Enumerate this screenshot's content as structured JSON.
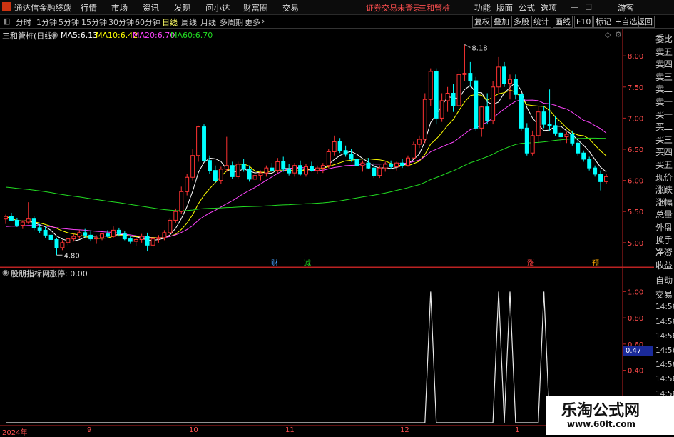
{
  "topbar": {
    "app_title": "通达信金融终端",
    "menus": [
      "行情",
      "市场",
      "资讯",
      "发现",
      "问小达",
      "财富圈",
      "交易"
    ],
    "alert": "证券交易未登录",
    "stock_name": "三和管桩",
    "right": [
      "功能",
      "版面",
      "公式",
      "选项"
    ],
    "user": "游客"
  },
  "periods": {
    "items": [
      "分时",
      "1分钟",
      "5分钟",
      "15分钟",
      "30分钟",
      "60分钟",
      "日线",
      "周线",
      "月线",
      "多周期",
      "更多"
    ],
    "active": "日线"
  },
  "toolbar": {
    "buttons": [
      "复权",
      "叠加",
      "多股",
      "统计",
      "画线",
      "F10",
      "标记",
      "+自选",
      "返回"
    ]
  },
  "side_panel": {
    "items": [
      "委比",
      "卖五",
      "卖四",
      "卖三",
      "卖二",
      "卖一",
      "买一",
      "买二",
      "买三",
      "买四",
      "买五",
      "现价",
      "涨跌",
      "涨幅",
      "总量",
      "外盘",
      "换手",
      "净资",
      "收益"
    ]
  },
  "main_chart": {
    "title": "三和管桩(日线)",
    "ma": [
      {
        "name": "MA5:",
        "value": "6.13",
        "color": "#ffffff"
      },
      {
        "name": "MA10:",
        "value": "6.42",
        "color": "#ffff00"
      },
      {
        "name": "MA20:",
        "value": "6.70",
        "color": "#ff44ff"
      },
      {
        "name": "MA60:",
        "value": "6.70",
        "color": "#22dd22"
      }
    ],
    "high_label": "8.18",
    "low_label": "4.80",
    "event_tags": [
      {
        "text": "财",
        "color": "#4aa3ff"
      },
      {
        "text": "减",
        "color": "#22dd22"
      },
      {
        "text": "涨",
        "color": "#ff4040"
      },
      {
        "text": "预",
        "color": "#ffaa00"
      }
    ],
    "y_ticks": [
      "8.00",
      "7.50",
      "7.00",
      "6.50",
      "6.00",
      "5.50",
      "5.00"
    ]
  },
  "sub_chart": {
    "title": "股朋指标网",
    "indicator": "涨停: 0.00",
    "y_ticks": [
      "1.00",
      "0.80",
      "0.60",
      "0.40"
    ],
    "current_value": "0.47",
    "side_items": [
      "自动",
      "交易",
      "14:56",
      "14:56",
      "14:56",
      "14:56",
      "14:56",
      "14:56",
      "14:56",
      "14:56"
    ]
  },
  "date_axis": [
    "2024年",
    "9",
    "10",
    "11",
    "12",
    "1"
  ],
  "watermark": {
    "title": "乐淘公式网",
    "url": "www.60lt.com"
  },
  "colors": {
    "up": "#ff3232",
    "down": "#00ffff",
    "ma5": "#ffffff",
    "ma10": "#ffff00",
    "ma20": "#ff44ff",
    "ma60": "#22dd22"
  },
  "chart_data": {
    "type": "candlestick",
    "title": "三和管桩(日线)",
    "ylim": [
      4.7,
      8.3
    ],
    "annotations": {
      "high": 8.18,
      "low": 4.8
    },
    "candles": [
      [
        5.38,
        5.45,
        5.3,
        5.42
      ],
      [
        5.42,
        5.48,
        5.35,
        5.36
      ],
      [
        5.36,
        5.4,
        5.25,
        5.28
      ],
      [
        5.28,
        5.36,
        5.22,
        5.33
      ],
      [
        5.33,
        5.65,
        5.3,
        5.38
      ],
      [
        5.38,
        5.42,
        5.2,
        5.24
      ],
      [
        5.24,
        5.3,
        5.15,
        5.2
      ],
      [
        5.2,
        5.26,
        5.08,
        5.12
      ],
      [
        5.12,
        5.18,
        5.0,
        5.05
      ],
      [
        5.05,
        5.08,
        4.8,
        4.92
      ],
      [
        4.92,
        5.04,
        4.88,
        5.0
      ],
      [
        5.0,
        5.08,
        4.96,
        5.06
      ],
      [
        5.06,
        5.14,
        5.02,
        5.1
      ],
      [
        5.1,
        5.2,
        5.06,
        5.16
      ],
      [
        5.16,
        5.22,
        5.08,
        5.12
      ],
      [
        5.12,
        5.18,
        5.02,
        5.06
      ],
      [
        5.06,
        5.12,
        4.98,
        5.08
      ],
      [
        5.08,
        5.16,
        5.04,
        5.14
      ],
      [
        5.14,
        5.2,
        5.08,
        5.1
      ],
      [
        5.1,
        5.26,
        5.08,
        5.2
      ],
      [
        5.2,
        5.24,
        5.1,
        5.14
      ],
      [
        5.14,
        5.18,
        5.04,
        5.06
      ],
      [
        5.06,
        5.1,
        4.98,
        5.02
      ],
      [
        5.02,
        5.08,
        4.95,
        5.05
      ],
      [
        5.05,
        5.14,
        5.0,
        5.1
      ],
      [
        5.1,
        5.16,
        4.86,
        4.96
      ],
      [
        4.96,
        5.1,
        4.9,
        5.06
      ],
      [
        5.06,
        5.12,
        5.0,
        5.08
      ],
      [
        5.08,
        5.2,
        5.04,
        5.16
      ],
      [
        5.16,
        5.4,
        5.12,
        5.36
      ],
      [
        5.36,
        5.55,
        5.32,
        5.5
      ],
      [
        5.5,
        5.9,
        5.46,
        5.82
      ],
      [
        5.82,
        6.1,
        5.76,
        6.05
      ],
      [
        6.05,
        6.5,
        6.0,
        6.4
      ],
      [
        6.4,
        6.88,
        6.3,
        6.86
      ],
      [
        6.86,
        6.9,
        6.3,
        6.32
      ],
      [
        6.32,
        6.4,
        6.1,
        6.16
      ],
      [
        6.16,
        6.24,
        5.96,
        6.0
      ],
      [
        6.0,
        6.22,
        5.94,
        6.18
      ],
      [
        6.18,
        6.7,
        6.14,
        6.24
      ],
      [
        6.24,
        6.3,
        6.02,
        6.06
      ],
      [
        6.06,
        6.3,
        6.02,
        6.26
      ],
      [
        6.26,
        6.34,
        6.14,
        6.18
      ],
      [
        6.18,
        6.24,
        5.98,
        6.02
      ],
      [
        6.02,
        6.1,
        5.94,
        6.08
      ],
      [
        6.08,
        6.16,
        6.0,
        6.12
      ],
      [
        6.12,
        6.24,
        6.06,
        6.2
      ],
      [
        6.2,
        6.28,
        6.12,
        6.16
      ],
      [
        6.16,
        6.36,
        6.12,
        6.3
      ],
      [
        6.3,
        6.38,
        6.14,
        6.18
      ],
      [
        6.18,
        6.26,
        6.08,
        6.12
      ],
      [
        6.12,
        6.28,
        6.06,
        6.24
      ],
      [
        6.24,
        6.32,
        6.08,
        6.1
      ],
      [
        6.1,
        6.26,
        6.06,
        6.22
      ],
      [
        6.22,
        6.3,
        6.14,
        6.16
      ],
      [
        6.16,
        6.24,
        6.1,
        6.2
      ],
      [
        6.2,
        6.28,
        6.12,
        6.24
      ],
      [
        6.24,
        6.5,
        6.2,
        6.46
      ],
      [
        6.46,
        6.72,
        6.4,
        6.62
      ],
      [
        6.62,
        6.68,
        6.44,
        6.48
      ],
      [
        6.48,
        6.56,
        6.38,
        6.42
      ],
      [
        6.42,
        6.5,
        6.3,
        6.34
      ],
      [
        6.34,
        6.4,
        6.2,
        6.24
      ],
      [
        6.24,
        6.32,
        6.14,
        6.28
      ],
      [
        6.28,
        6.36,
        6.18,
        6.2
      ],
      [
        6.2,
        6.28,
        6.04,
        6.08
      ],
      [
        6.08,
        6.24,
        6.04,
        6.2
      ],
      [
        6.2,
        6.3,
        6.14,
        6.26
      ],
      [
        6.26,
        6.32,
        6.18,
        6.22
      ],
      [
        6.22,
        6.3,
        6.16,
        6.28
      ],
      [
        6.28,
        6.34,
        6.2,
        6.24
      ],
      [
        6.24,
        6.4,
        6.22,
        6.36
      ],
      [
        6.36,
        6.62,
        6.34,
        6.58
      ],
      [
        6.58,
        6.72,
        6.52,
        6.66
      ],
      [
        6.66,
        7.4,
        6.6,
        7.3
      ],
      [
        7.3,
        7.8,
        7.2,
        7.75
      ],
      [
        7.75,
        7.8,
        6.9,
        7.0
      ],
      [
        7.0,
        7.4,
        6.94,
        7.28
      ],
      [
        7.28,
        7.5,
        7.1,
        7.4
      ],
      [
        7.4,
        7.55,
        7.1,
        7.2
      ],
      [
        7.2,
        7.8,
        7.16,
        7.7
      ],
      [
        7.7,
        8.18,
        7.6,
        7.72
      ],
      [
        7.72,
        7.9,
        7.5,
        7.6
      ],
      [
        7.6,
        7.66,
        6.8,
        6.84
      ],
      [
        6.84,
        7.2,
        6.7,
        7.18
      ],
      [
        7.18,
        7.4,
        6.9,
        6.96
      ],
      [
        6.96,
        7.6,
        6.9,
        7.5
      ],
      [
        7.5,
        7.98,
        7.4,
        7.82
      ],
      [
        7.82,
        7.9,
        7.5,
        7.56
      ],
      [
        7.56,
        7.7,
        7.3,
        7.62
      ],
      [
        7.62,
        7.7,
        7.3,
        7.38
      ],
      [
        7.38,
        7.4,
        6.8,
        6.84
      ],
      [
        6.84,
        6.92,
        6.4,
        6.44
      ],
      [
        6.44,
        6.8,
        6.4,
        6.72
      ],
      [
        6.72,
        7.2,
        6.6,
        7.1
      ],
      [
        7.1,
        7.2,
        6.84,
        6.9
      ],
      [
        6.9,
        7.46,
        6.8,
        6.88
      ],
      [
        6.88,
        7.04,
        6.72,
        6.76
      ],
      [
        6.76,
        6.84,
        6.6,
        6.7
      ],
      [
        6.7,
        6.78,
        6.6,
        6.74
      ],
      [
        6.74,
        6.8,
        6.56,
        6.6
      ],
      [
        6.6,
        6.66,
        6.4,
        6.44
      ],
      [
        6.44,
        6.48,
        6.3,
        6.34
      ],
      [
        6.34,
        6.38,
        6.16,
        6.2
      ],
      [
        6.2,
        6.24,
        6.06,
        6.1
      ],
      [
        6.1,
        6.16,
        5.84,
        5.98
      ],
      [
        5.98,
        6.1,
        5.94,
        6.06
      ]
    ],
    "limit_up_signal": {
      "days": [
        75,
        87,
        89,
        95
      ],
      "values": [
        1.0,
        1.0,
        1.0,
        1.0
      ]
    },
    "sub_ylim": [
      0,
      1.1
    ]
  }
}
